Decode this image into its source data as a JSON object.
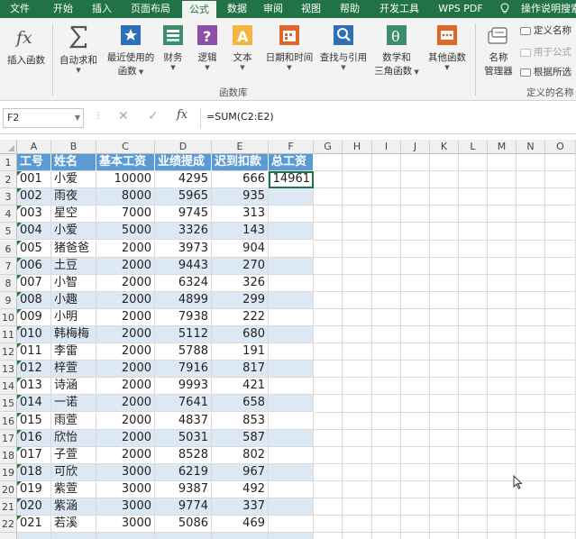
{
  "ribbon_tabs": [
    {
      "label": "文件",
      "active": false
    },
    {
      "label": "开始",
      "active": false
    },
    {
      "label": "插入",
      "active": false
    },
    {
      "label": "页面布局",
      "active": false
    },
    {
      "label": "公式",
      "active": true
    },
    {
      "label": "数据",
      "active": false
    },
    {
      "label": "审阅",
      "active": false
    },
    {
      "label": "视图",
      "active": false
    },
    {
      "label": "帮助",
      "active": false
    },
    {
      "label": "开发工具",
      "active": false
    },
    {
      "label": "WPS PDF",
      "active": false
    }
  ],
  "search_hint": "操作说明搜索",
  "ribbon": {
    "insert_function": "插入函数",
    "autosum": "自动求和",
    "recently_used": [
      "最近使用的",
      "函数"
    ],
    "financial": "财务",
    "logical": "逻辑",
    "text": "文本",
    "datetime": "日期和时间",
    "lookup": "查找与引用",
    "math": [
      "数学和",
      "三角函数"
    ],
    "more": "其他函数",
    "library_label": "函数库",
    "name_manager": [
      "名称",
      "管理器"
    ],
    "define_name": "定义名称",
    "use_in_formula": "用于公式",
    "create_from_selection": "根据所选",
    "defined_names_label": "定义的名称"
  },
  "formula_bar": {
    "name_box": "F2",
    "formula": "=SUM(C2:E2)"
  },
  "columns": [
    "A",
    "B",
    "C",
    "D",
    "E",
    "F",
    "G",
    "H",
    "I",
    "J",
    "K",
    "L",
    "M",
    "N",
    "O"
  ],
  "headers": [
    "工号",
    "姓名",
    "基本工资",
    "业绩提成",
    "迟到扣款",
    "总工资"
  ],
  "rows": [
    {
      "n": "2",
      "id": "001",
      "name": "小爱",
      "base": "10000",
      "bonus": "4295",
      "late": "666",
      "total": "14961"
    },
    {
      "n": "3",
      "id": "002",
      "name": "雨夜",
      "base": "8000",
      "bonus": "5965",
      "late": "935",
      "total": ""
    },
    {
      "n": "4",
      "id": "003",
      "name": "星空",
      "base": "7000",
      "bonus": "9745",
      "late": "313",
      "total": ""
    },
    {
      "n": "5",
      "id": "004",
      "name": "小爱",
      "base": "5000",
      "bonus": "3326",
      "late": "143",
      "total": ""
    },
    {
      "n": "6",
      "id": "005",
      "name": "猪爸爸",
      "base": "2000",
      "bonus": "3973",
      "late": "904",
      "total": ""
    },
    {
      "n": "7",
      "id": "006",
      "name": "土豆",
      "base": "2000",
      "bonus": "9443",
      "late": "270",
      "total": ""
    },
    {
      "n": "8",
      "id": "007",
      "name": "小智",
      "base": "2000",
      "bonus": "6324",
      "late": "326",
      "total": ""
    },
    {
      "n": "9",
      "id": "008",
      "name": "小趣",
      "base": "2000",
      "bonus": "4899",
      "late": "299",
      "total": ""
    },
    {
      "n": "10",
      "id": "009",
      "name": "小明",
      "base": "2000",
      "bonus": "7938",
      "late": "222",
      "total": ""
    },
    {
      "n": "11",
      "id": "010",
      "name": "韩梅梅",
      "base": "2000",
      "bonus": "5112",
      "late": "680",
      "total": ""
    },
    {
      "n": "12",
      "id": "011",
      "name": "李雷",
      "base": "2000",
      "bonus": "5788",
      "late": "191",
      "total": ""
    },
    {
      "n": "13",
      "id": "012",
      "name": "梓萱",
      "base": "2000",
      "bonus": "7916",
      "late": "817",
      "total": ""
    },
    {
      "n": "14",
      "id": "013",
      "name": "诗涵",
      "base": "2000",
      "bonus": "9993",
      "late": "421",
      "total": ""
    },
    {
      "n": "15",
      "id": "014",
      "name": "一诺",
      "base": "2000",
      "bonus": "7641",
      "late": "658",
      "total": ""
    },
    {
      "n": "16",
      "id": "015",
      "name": "雨萱",
      "base": "2000",
      "bonus": "4837",
      "late": "853",
      "total": ""
    },
    {
      "n": "17",
      "id": "016",
      "name": "欣怡",
      "base": "2000",
      "bonus": "5031",
      "late": "587",
      "total": ""
    },
    {
      "n": "18",
      "id": "017",
      "name": "子萱",
      "base": "2000",
      "bonus": "8528",
      "late": "802",
      "total": ""
    },
    {
      "n": "19",
      "id": "018",
      "name": "可欣",
      "base": "3000",
      "bonus": "6219",
      "late": "967",
      "total": ""
    },
    {
      "n": "20",
      "id": "019",
      "name": "紫萱",
      "base": "3000",
      "bonus": "9387",
      "late": "492",
      "total": ""
    },
    {
      "n": "21",
      "id": "020",
      "name": "紫涵",
      "base": "3000",
      "bonus": "9774",
      "late": "337",
      "total": ""
    },
    {
      "n": "22",
      "id": "021",
      "name": "若溪",
      "base": "3000",
      "bonus": "5086",
      "late": "469",
      "total": ""
    }
  ],
  "theme": {
    "excel_green": "#217346",
    "table_header_blue": "#5b9bd5",
    "band_blue": "#dde8f5"
  }
}
